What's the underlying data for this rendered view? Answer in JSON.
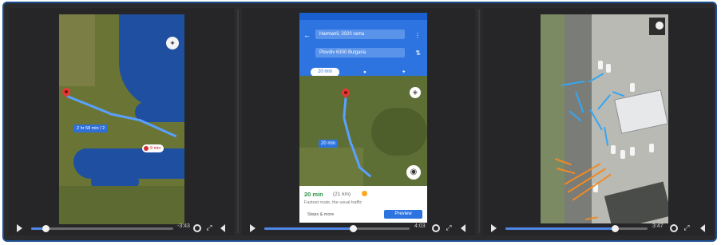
{
  "panels": [
    {
      "id": "panel-1",
      "map": {
        "route_label": "2 hr 58 min / 2",
        "destination_label": "9 min"
      },
      "player": {
        "time": "-3:43",
        "progress": 0.1
      }
    },
    {
      "id": "panel-2",
      "header": {
        "from": "Harmanli, 2020 rama",
        "to": "Plovdiv 6300 Bulgaria",
        "mode_selected": "20 min"
      },
      "map": {
        "route_duration_label": "20 min"
      },
      "card": {
        "time": "20 min",
        "distance": "(21 km)",
        "subtitle": "Fastest route, the usual traffic",
        "steps": "Steps & more",
        "start_label": "Preview"
      },
      "player": {
        "time": "4:03",
        "progress": 0.61
      }
    },
    {
      "id": "panel-3",
      "player": {
        "time": "3:47",
        "progress": 0.77
      }
    }
  ],
  "colors": {
    "frame_border": "#1d4f91",
    "player_bg": "#262628",
    "progress_fill": "#4f86e8",
    "route": "#5aa0ff",
    "annotation_blue": "#35a6f4",
    "annotation_orange": "#f08a24"
  },
  "icons": [
    "play-icon",
    "settings-icon",
    "fullscreen-icon",
    "volume-icon",
    "compass-icon",
    "map-pin-icon",
    "layers-icon",
    "street-view-icon"
  ]
}
